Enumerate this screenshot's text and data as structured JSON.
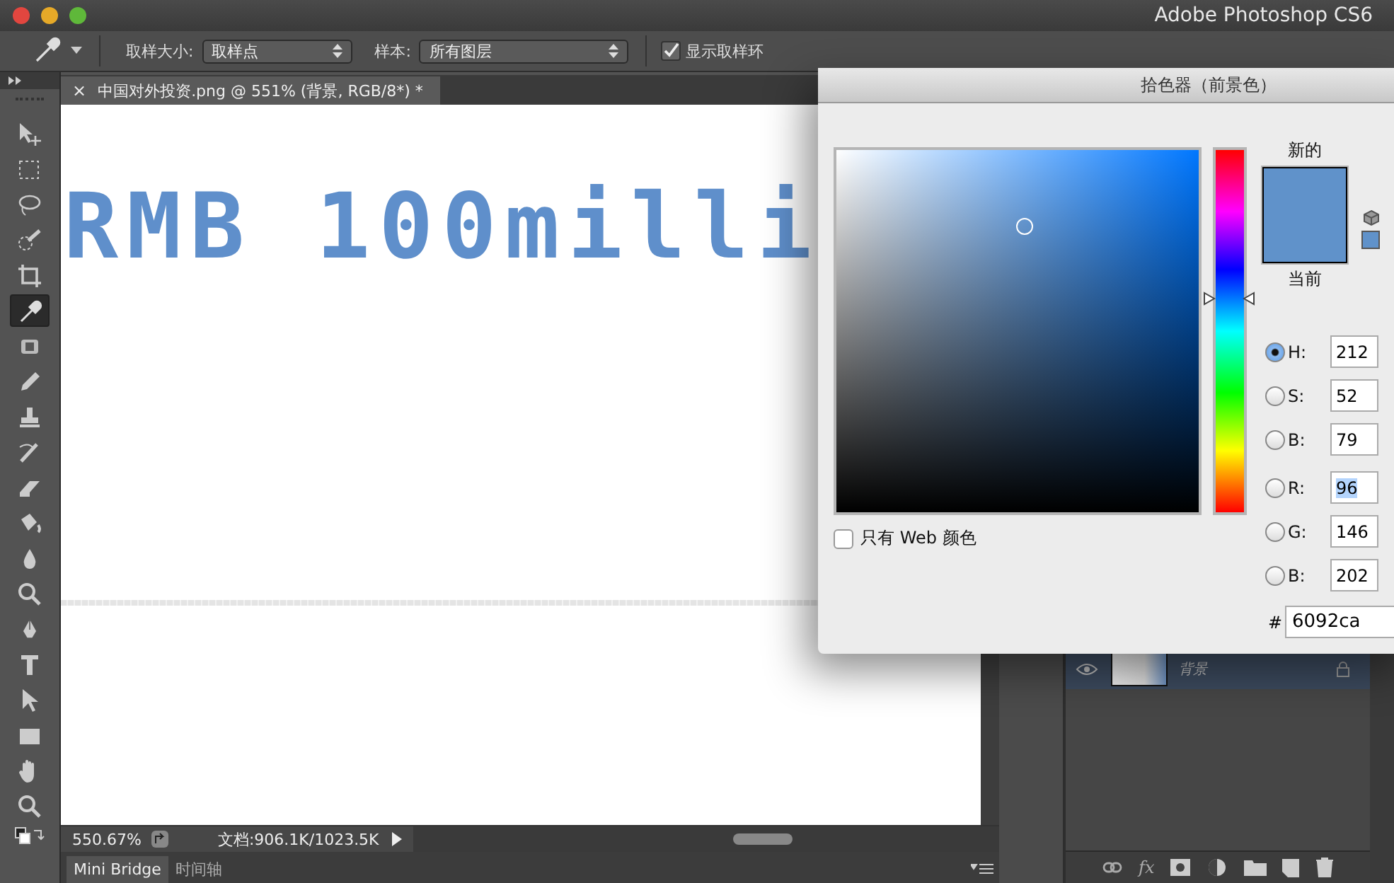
{
  "window": {
    "title": "Adobe Photoshop CS6"
  },
  "options_bar": {
    "sample_size_label": "取样大小:",
    "sample_size_value": "取样点",
    "sample_label": "样本:",
    "sample_value": "所有图层",
    "show_ring": {
      "label": "显示取样环",
      "checked": true
    }
  },
  "tools": [
    {
      "kind": "move",
      "selected": false
    },
    {
      "kind": "marquee",
      "selected": false
    },
    {
      "kind": "lasso",
      "selected": false
    },
    {
      "kind": "quick-select",
      "selected": false
    },
    {
      "kind": "crop",
      "selected": false
    },
    {
      "kind": "eyedropper",
      "selected": true
    },
    {
      "kind": "healing",
      "selected": false
    },
    {
      "kind": "brush",
      "selected": false
    },
    {
      "kind": "stamp",
      "selected": false
    },
    {
      "kind": "history-brush",
      "selected": false
    },
    {
      "kind": "eraser",
      "selected": false
    },
    {
      "kind": "bucket",
      "selected": false
    },
    {
      "kind": "blur",
      "selected": false
    },
    {
      "kind": "zoom",
      "selected": false
    },
    {
      "kind": "pen",
      "selected": false
    },
    {
      "kind": "type",
      "selected": false
    },
    {
      "kind": "path-select",
      "selected": false
    },
    {
      "kind": "rectangle",
      "selected": false
    },
    {
      "kind": "hand",
      "selected": false
    },
    {
      "kind": "zoom",
      "selected": false
    }
  ],
  "document_tab": {
    "close": "×",
    "title": "中国对外投资.png @ 551% (背景, RGB/8*) *"
  },
  "canvas": {
    "text": "RMB 100milli"
  },
  "status_bar": {
    "zoom": "550.67%",
    "doc_info": "文档:906.1K/1023.5K"
  },
  "bottom_tabs": [
    {
      "label": "Mini Bridge",
      "selected": true
    },
    {
      "label": "时间轴",
      "selected": false
    }
  ],
  "layers": [
    {
      "name": "背景",
      "visible": true,
      "locked": true
    }
  ],
  "layer_footer": {
    "fx": "fx"
  },
  "color_picker": {
    "title": "拾色器（前景色）",
    "new_label": "新的",
    "current_label": "当前",
    "web_only": {
      "label": "只有 Web 颜色",
      "checked": false
    },
    "fields": [
      {
        "label": "H:",
        "value": "212",
        "selected": true,
        "highlighted": false
      },
      {
        "label": "S:",
        "value": "52",
        "selected": false,
        "highlighted": false
      },
      {
        "label": "B:",
        "value": "79",
        "selected": false,
        "highlighted": false
      },
      {
        "label": "R:",
        "value": "96",
        "selected": false,
        "highlighted": true
      },
      {
        "label": "G:",
        "value": "146",
        "selected": false,
        "highlighted": false
      },
      {
        "label": "B:",
        "value": "202",
        "selected": false,
        "highlighted": false
      }
    ],
    "hue_slider": {
      "level": 0.589
    },
    "hex_label": "#",
    "hex": "6092ca"
  }
}
